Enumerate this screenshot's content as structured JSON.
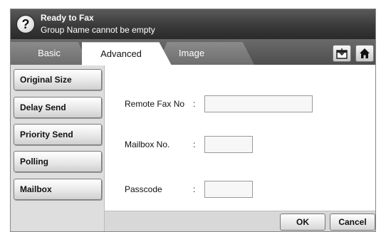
{
  "header": {
    "status_title": "Ready to Fax",
    "status_message": "Group Name cannot be empty",
    "help_glyph": "?",
    "help_icon": "question-icon"
  },
  "tabs": [
    {
      "label": "Basic",
      "active": false
    },
    {
      "label": "Advanced",
      "active": true
    },
    {
      "label": "Image",
      "active": false
    }
  ],
  "toolbar": {
    "job_status_icon": "job-status-icon",
    "home_icon": "home-icon"
  },
  "menu": {
    "items": [
      {
        "label": "Original Size"
      },
      {
        "label": "Delay Send"
      },
      {
        "label": "Priority Send"
      },
      {
        "label": "Polling"
      },
      {
        "label": "Mailbox"
      }
    ]
  },
  "form": {
    "colon": ":",
    "fields": [
      {
        "label": "Remote Fax No",
        "value": ""
      },
      {
        "label": "Mailbox No.",
        "value": ""
      },
      {
        "label": "Passcode",
        "value": ""
      }
    ]
  },
  "buttons": {
    "ok": "OK",
    "cancel": "Cancel"
  },
  "colors": {
    "header_dark": "#3a3a3a",
    "panel_bg": "#ffffff",
    "menu_bg": "#dedede"
  }
}
